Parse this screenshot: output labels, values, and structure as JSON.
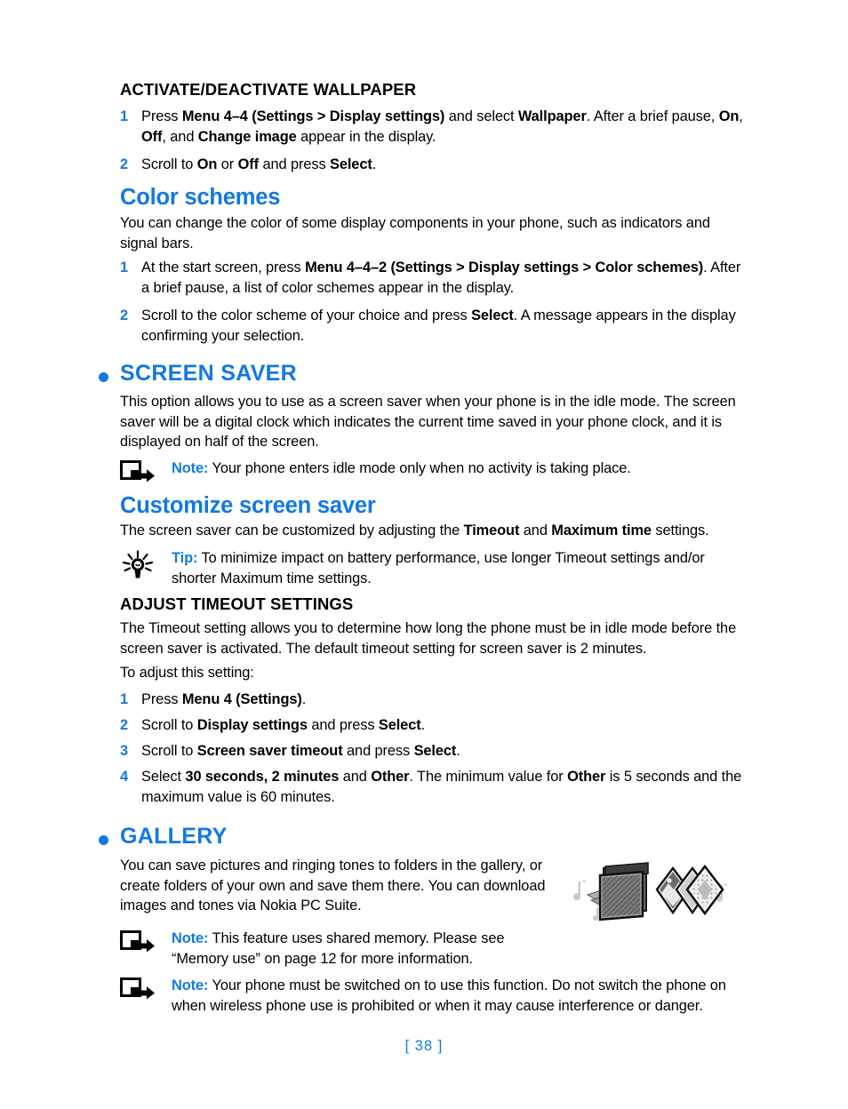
{
  "page": {
    "number_label": "[ 38 ]",
    "accent_blue": "#1278e4",
    "text_black": "#000000"
  },
  "sections": {
    "activate_wallpaper": {
      "heading": "ACTIVATE/DEACTIVATE WALLPAPER",
      "steps": [
        {
          "number": "1",
          "runs": [
            {
              "t": "Press ",
              "b": false
            },
            {
              "t": "Menu 4–4 (Settings > Display settings)",
              "b": true
            },
            {
              "t": " and select ",
              "b": false
            },
            {
              "t": "Wallpaper",
              "b": true
            },
            {
              "t": ". After a brief pause, ",
              "b": false
            },
            {
              "t": "On",
              "b": true
            },
            {
              "t": ", ",
              "b": false
            },
            {
              "t": "Off",
              "b": true
            },
            {
              "t": ", and ",
              "b": false
            },
            {
              "t": "Change image",
              "b": true
            },
            {
              "t": " appear in the display.",
              "b": false
            }
          ]
        },
        {
          "number": "2",
          "runs": [
            {
              "t": "Scroll to ",
              "b": false
            },
            {
              "t": "On",
              "b": true
            },
            {
              "t": " or ",
              "b": false
            },
            {
              "t": "Off",
              "b": true
            },
            {
              "t": " and press ",
              "b": false
            },
            {
              "t": "Select",
              "b": true
            },
            {
              "t": ".",
              "b": false
            }
          ]
        }
      ]
    },
    "color_schemes": {
      "heading": "Color schemes",
      "intro": "You can change the color of some display components in your phone, such as indicators and signal bars.",
      "steps": [
        {
          "number": "1",
          "runs": [
            {
              "t": "At the start screen, press ",
              "b": false
            },
            {
              "t": "Menu 4–4–2 (Settings > Display settings > Color schemes)",
              "b": true
            },
            {
              "t": ". After a brief pause, a list of color schemes appear in the display.",
              "b": false
            }
          ]
        },
        {
          "number": "2",
          "runs": [
            {
              "t": "Scroll to the color scheme of your choice and press ",
              "b": false
            },
            {
              "t": "Select",
              "b": true
            },
            {
              "t": ". A message appears in the display confirming your selection.",
              "b": false
            }
          ]
        }
      ]
    },
    "screen_saver": {
      "heading": "SCREEN SAVER",
      "bullet_icon": "bullet-dot-icon",
      "intro": "This option allows you to use as a screen saver when your phone is in the idle mode. The screen saver will be a digital clock which indicates the current time saved in your phone clock, and it is displayed on half of the screen.",
      "note": {
        "icon": "note-arrow-icon",
        "label": "Note:",
        "text": " Your phone enters idle mode only when no activity is taking place."
      }
    },
    "customize_screen_saver": {
      "heading": "Customize screen saver",
      "intro_runs": [
        {
          "t": "The screen saver can be customized by adjusting the ",
          "b": false
        },
        {
          "t": "Timeout",
          "b": true
        },
        {
          "t": " and ",
          "b": false
        },
        {
          "t": "Maximum time",
          "b": true
        },
        {
          "t": " settings.",
          "b": false
        }
      ],
      "tip": {
        "icon": "lightbulb-icon",
        "label": "Tip:",
        "text": "  To minimize impact on battery performance, use longer Timeout settings and/or shorter Maximum time settings."
      }
    },
    "adjust_timeout": {
      "heading": "ADJUST TIMEOUT SETTINGS",
      "intro": "The Timeout setting allows you to determine how long the phone must be in idle mode before the screen saver is activated. The default timeout setting for screen saver is 2 minutes.",
      "lead_in": "To adjust this setting:",
      "steps": [
        {
          "number": "1",
          "runs": [
            {
              "t": "Press ",
              "b": false
            },
            {
              "t": "Menu 4 (Settings)",
              "b": true
            },
            {
              "t": ".",
              "b": false
            }
          ]
        },
        {
          "number": "2",
          "runs": [
            {
              "t": "Scroll to ",
              "b": false
            },
            {
              "t": "Display settings",
              "b": true
            },
            {
              "t": " and press ",
              "b": false
            },
            {
              "t": "Select",
              "b": true
            },
            {
              "t": ".",
              "b": false
            }
          ]
        },
        {
          "number": "3",
          "runs": [
            {
              "t": "Scroll to ",
              "b": false
            },
            {
              "t": "Screen saver timeout",
              "b": true
            },
            {
              "t": " and press ",
              "b": false
            },
            {
              "t": "Select",
              "b": true
            },
            {
              "t": ".",
              "b": false
            }
          ]
        },
        {
          "number": "4",
          "runs": [
            {
              "t": "Select ",
              "b": false
            },
            {
              "t": "30 seconds, 2 minutes",
              "b": true
            },
            {
              "t": " and ",
              "b": false
            },
            {
              "t": "Other",
              "b": true
            },
            {
              "t": ". The minimum value for ",
              "b": false
            },
            {
              "t": "Other",
              "b": true
            },
            {
              "t": " is 5 seconds and the maximum value is 60 minutes.",
              "b": false
            }
          ]
        }
      ]
    },
    "gallery": {
      "heading": "GALLERY",
      "bullet_icon": "bullet-dot-icon",
      "intro": "You can save pictures and ringing tones to folders in the gallery, or create folders of your own and save them there. You can download images and tones via Nokia PC Suite.",
      "illustration": "gallery-folder-photos-music-illustration",
      "notes": [
        {
          "icon": "note-arrow-icon",
          "label": "Note:",
          "text": " This feature uses shared memory. Please see “Memory use” on page 12 for more information."
        },
        {
          "icon": "note-arrow-icon",
          "label": "Note:",
          "text": " Your phone must be switched on to use this function. Do not switch the phone on when wireless phone use is prohibited or when it may cause interference or danger."
        }
      ]
    }
  }
}
